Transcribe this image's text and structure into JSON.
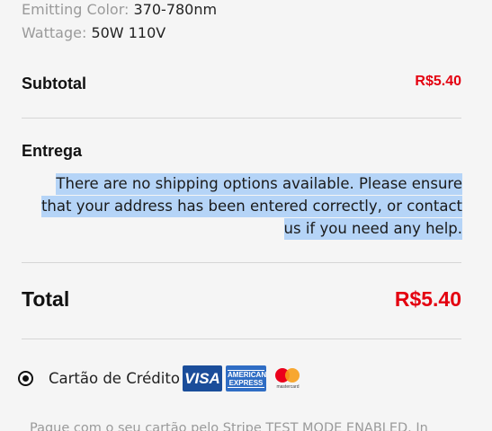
{
  "product_attributes": [
    {
      "key": "Emitting Color:",
      "value": "370-780nm"
    },
    {
      "key": "Wattage:",
      "value": "50W 110V"
    }
  ],
  "subtotal": {
    "label": "Subtotal",
    "value": "R$5.40"
  },
  "shipping": {
    "label": "Entrega",
    "message": "There are no shipping options available. Please ensure that your address has been entered correctly, or contact us if you need any help."
  },
  "total": {
    "label": "Total",
    "value": "R$5.40"
  },
  "payment": {
    "method_label": "Cartão de Crédito",
    "selected": true,
    "cards": [
      {
        "icon": "visa-icon",
        "text": "VISA"
      },
      {
        "icon": "amex-icon",
        "text": "AMERICAN EXPRESS"
      },
      {
        "icon": "mastercard-icon",
        "text": "mastercard"
      }
    ],
    "description": "Pague com o seu cartão pelo Stripe TEST MODE ENABLED. In"
  },
  "colors": {
    "price_red": "#e4000f",
    "selection_blue": "#b5d4f7",
    "visa_blue": "#1a4d9a",
    "amex_blue": "#2f6dc4"
  }
}
